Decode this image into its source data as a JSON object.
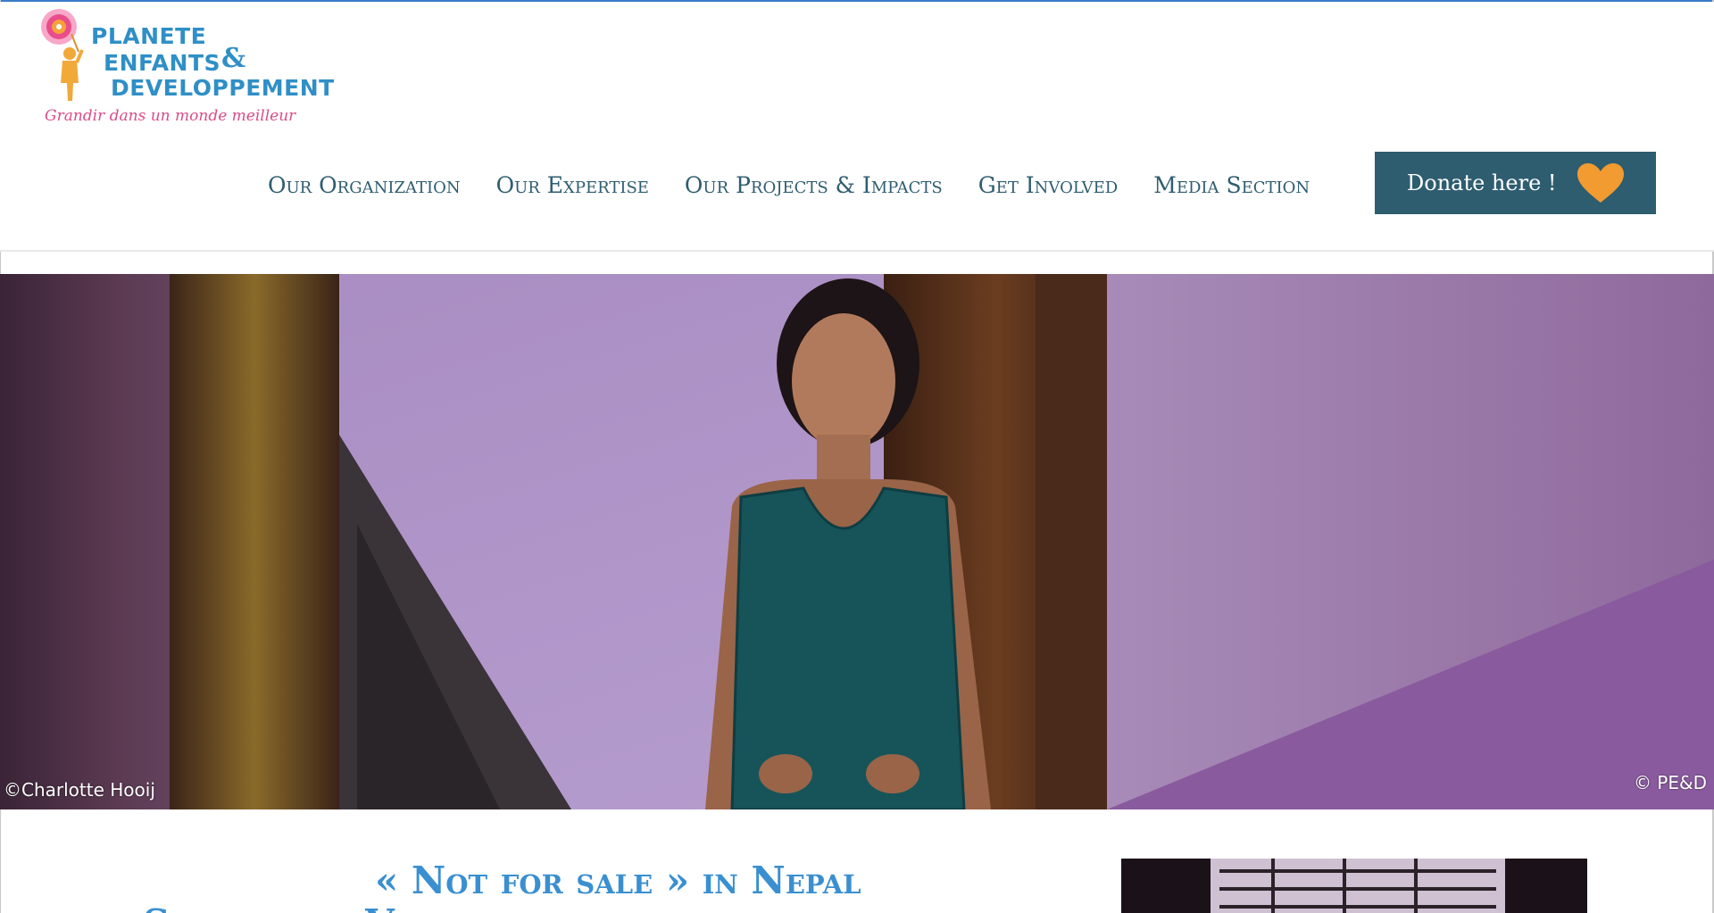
{
  "header": {
    "logo": {
      "line1": "PLANETE",
      "line2": "ENFANTS",
      "amp": "&",
      "line3": "DEVELOPPEMENT",
      "tagline": "Grandir dans un monde meilleur"
    },
    "nav": [
      {
        "label": "Our Organization"
      },
      {
        "label": "Our Expertise"
      },
      {
        "label": "Our Projects & Impacts"
      },
      {
        "label": "Get Involved"
      },
      {
        "label": "Media Section"
      }
    ],
    "donate": {
      "label": "Donate here !",
      "icon": "heart-icon"
    }
  },
  "hero": {
    "credit_left": "©Charlotte Hooij",
    "credit_right": "© PE&D"
  },
  "article": {
    "title": "« Not for sale » in Nepal",
    "subtitle": "Supporting V"
  },
  "colors": {
    "nav_text": "#2e5d70",
    "donate_bg": "#2e5d70",
    "heart": "#f29b30",
    "title_blue": "#3a8fd0",
    "logo_blue": "#2f8fc6",
    "tagline_pink": "#d94c8a"
  }
}
